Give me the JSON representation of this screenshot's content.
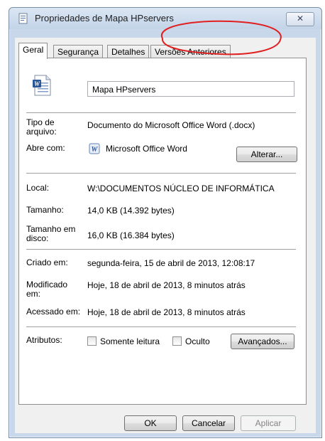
{
  "window": {
    "title": "Propriedades de Mapa HPservers",
    "close_icon": "close-icon"
  },
  "tabs": [
    {
      "label": "Geral",
      "active": true
    },
    {
      "label": "Segurança",
      "active": false
    },
    {
      "label": "Detalhes",
      "active": false
    },
    {
      "label": "Versões Anteriores",
      "active": false
    }
  ],
  "general": {
    "file_icon": "word-document-icon",
    "name_value": "Mapa HPservers",
    "type_label": "Tipo de arquivo:",
    "type_value": "Documento do Microsoft Office Word (.docx)",
    "opens_with_label": "Abre com:",
    "opens_with_icon": "word-app-icon",
    "opens_with_value": "Microsoft Office Word",
    "change_button": "Alterar...",
    "location_label": "Local:",
    "location_value": "W:\\DOCUMENTOS NÚCLEO DE INFORMÁTICA",
    "size_label": "Tamanho:",
    "size_value": "14,0 KB (14.392 bytes)",
    "size_on_disk_label": "Tamanho em disco:",
    "size_on_disk_value": "16,0 KB (16.384 bytes)",
    "created_label": "Criado em:",
    "created_value": "segunda-feira, 15 de abril de 2013, 12:08:17",
    "modified_label": "Modificado em:",
    "modified_value": "Hoje, 18 de abril de 2013, 8 minutos atrás",
    "accessed_label": "Acessado em:",
    "accessed_value": "Hoje, 18 de abril de 2013, 8 minutos atrás",
    "attributes_label": "Atributos:",
    "readonly_label": "Somente leitura",
    "readonly_checked": false,
    "hidden_label": "Oculto",
    "hidden_checked": false,
    "advanced_button": "Avançados..."
  },
  "footer": {
    "ok_button": "OK",
    "cancel_button": "Cancelar",
    "apply_button": "Aplicar"
  },
  "colors": {
    "annotation": "#e02020",
    "word_blue": "#2b5797"
  }
}
